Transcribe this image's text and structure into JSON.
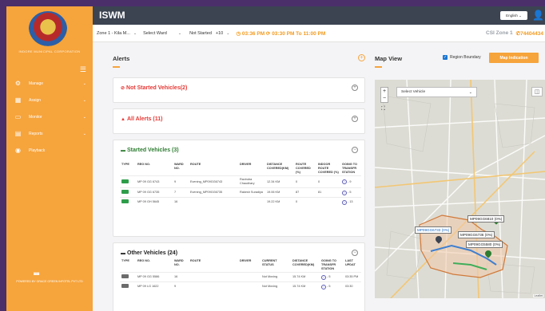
{
  "app": {
    "title": "ISWM",
    "language": "English",
    "corporation": "INDORE MUNICIPAL CORPORATION"
  },
  "sidebar": {
    "items": [
      {
        "label": "Manage",
        "icon": "gear-icon",
        "has_children": true
      },
      {
        "label": "Assign",
        "icon": "calendar-icon",
        "has_children": true
      },
      {
        "label": "Monitor",
        "icon": "monitor-icon",
        "has_children": true
      },
      {
        "label": "Reports",
        "icon": "clipboard-icon",
        "has_children": true
      },
      {
        "label": "Playback",
        "icon": "play-icon",
        "has_children": false
      }
    ],
    "powered_by": "POWERED BY GRACE GREEN INFOTEL PVT LTD"
  },
  "filters": {
    "zone": "Zone 1 - Kila M...",
    "ward": "Select Ward",
    "status": "Not Started",
    "more": "+10",
    "time_now": "03:36 PM",
    "time_range": "03:30 PM To 11:00 PM",
    "user_zone": "CSI Zone 1",
    "phone": "74404434"
  },
  "alerts": {
    "title": "Alerts",
    "not_started": "Not Started Vehicles(2)",
    "all_alerts": "All Alerts (11)",
    "started": {
      "title": "Started Vehicles (3)",
      "headers": [
        "TYPE",
        "REG NO.",
        "WARD NO.",
        "ROUTE",
        "DRIVER",
        "DISTANCE COVERED(KM)",
        "ROUTE COVERED (%)",
        "INDOOR ROUTE COVERED (%)",
        "GOING TO TRANSFR STATION"
      ],
      "rows": [
        {
          "reg": "MP 09 GG 6743",
          "ward": "9",
          "route": "Evening_MP09GG6743",
          "driver": "Ravindra Chaudhary",
          "distance": "12.34 KM",
          "route_pct": "0",
          "indoor_pct": "0",
          "station": "- 9"
        },
        {
          "reg": "MP 09 GG 6735",
          "ward": "7",
          "route": "Evening_MP09GG6735",
          "driver": "Rakesh Suradiya",
          "distance": "19.06 KM",
          "route_pct": "87",
          "indoor_pct": "81",
          "station": "- 5"
        },
        {
          "reg": "MP 09 GH 5645",
          "ward": "16",
          "route": "",
          "driver": "",
          "distance": "19.22 KM",
          "route_pct": "0",
          "indoor_pct": "",
          "station": "- 13"
        }
      ]
    },
    "other": {
      "title": "Other Vehicles (24)",
      "headers": [
        "TYPE",
        "REG NO.",
        "WARD NO.",
        "ROUTE",
        "DRIVER",
        "CURRENT STATUS",
        "DISTANCE COVERED(KM)",
        "GOING TO TRANSFR STATION",
        "LAST UPDAT"
      ],
      "rows": [
        {
          "reg": "MP 09 GG 5586",
          "ward": "16",
          "route": "",
          "driver": "",
          "status": "Not Moving",
          "distance": "15.74 KM",
          "station": "- 5",
          "last": "03:35 PM"
        },
        {
          "reg": "MP 09 LG 1622",
          "ward": "9",
          "route": "",
          "driver": "",
          "status": "Not Moving",
          "distance": "15.74 KM",
          "station": "- 5",
          "last": "03:30"
        }
      ]
    }
  },
  "map": {
    "title": "Map View",
    "region_boundary": "Region Boundary",
    "indication_button": "Map Indication",
    "vehicle_select": "Select Vehicle",
    "labels": [
      "MP09GG6810 (0%)",
      "MP09GG6733 (0%)",
      "MP09GG6736 (0%)",
      "MP09GG5580 (0%)"
    ],
    "attribution": "Leaflet"
  },
  "colors": {
    "accent": "#f6a43c",
    "header": "#3c4452",
    "red": "#e53935",
    "green": "#2e7d32"
  }
}
